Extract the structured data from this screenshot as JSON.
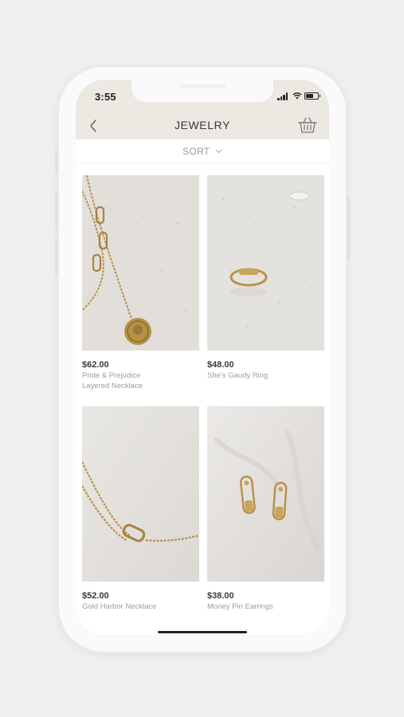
{
  "status_bar": {
    "time": "3:55"
  },
  "header": {
    "title": "JEWELRY"
  },
  "sort": {
    "label": "SORT"
  },
  "products": [
    {
      "price": "$62.00",
      "name_line1": "Pride & Prejudice",
      "name_line2": "Layered Necklace"
    },
    {
      "price": "$48.00",
      "name_line1": "She's Gaudy Ring",
      "name_line2": ""
    },
    {
      "price": "$52.00",
      "name_line1": "Gold Harbor Necklace",
      "name_line2": ""
    },
    {
      "price": "$38.00",
      "name_line1": "Money Pin Earrings",
      "name_line2": ""
    }
  ],
  "icons": {
    "back": "chevron-left-icon",
    "cart": "basket-icon",
    "sort": "chevron-down-icon"
  },
  "colors": {
    "background": "#efefef",
    "header": "#ece9e3",
    "price": "#3a3a3a",
    "product_name": "#9d9d9d",
    "gold": "#b8924c"
  }
}
